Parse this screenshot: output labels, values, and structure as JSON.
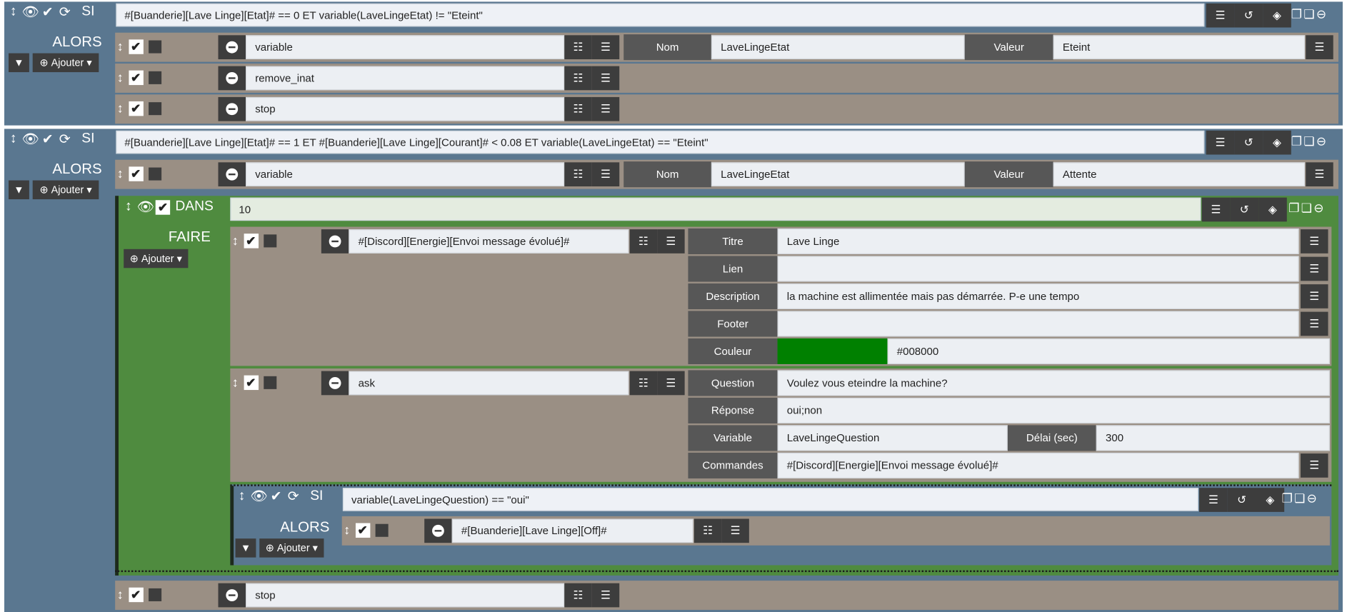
{
  "block1": {
    "si": "SI",
    "condition": "#[Buanderie][Lave Linge][Etat]# == 0  ET variable(LaveLingeEtat)  != \"Eteint\"",
    "alors": "ALORS",
    "ajouter": "Ajouter",
    "actions": [
      {
        "name": "variable",
        "nom_label": "Nom",
        "nom": "LaveLingeEtat",
        "valeur_label": "Valeur",
        "valeur": "Eteint"
      },
      {
        "name": "remove_inat"
      },
      {
        "name": "stop"
      }
    ]
  },
  "block2": {
    "si": "SI",
    "condition": "#[Buanderie][Lave Linge][Etat]# == 1 ET #[Buanderie][Lave Linge][Courant]# < 0.08  ET variable(LaveLingeEtat)  == \"Eteint\"",
    "alors": "ALORS",
    "ajouter": "Ajouter",
    "action1": {
      "name": "variable",
      "nom_label": "Nom",
      "nom": "LaveLingeEtat",
      "valeur_label": "Valeur",
      "valeur": "Attente"
    },
    "dans": {
      "label": "DANS",
      "value": "10",
      "faire": "FAIRE",
      "ajouter": "Ajouter",
      "discord": {
        "name": "#[Discord][Energie][Envoi message évolué]#",
        "titre_label": "Titre",
        "titre": "Lave Linge",
        "lien_label": "Lien",
        "lien": "",
        "description_label": "Description",
        "description": "la machine est allimentée mais pas démarrée. P-e une tempo",
        "footer_label": "Footer",
        "footer": "",
        "couleur_label": "Couleur",
        "couleur": "#008000"
      },
      "ask": {
        "name": "ask",
        "question_label": "Question",
        "question": "Voulez vous eteindre la machine?",
        "reponse_label": "Réponse",
        "reponse": "oui;non",
        "variable_label": "Variable",
        "variable": "LaveLingeQuestion",
        "delai_label": "Délai (sec)",
        "delai": "300",
        "commandes_label": "Commandes",
        "commandes": "#[Discord][Energie][Envoi message évolué]#"
      },
      "inner": {
        "si": "SI",
        "condition": "variable(LaveLingeQuestion)  == \"oui\"",
        "alors": "ALORS",
        "ajouter": "Ajouter",
        "action": "#[Buanderie][Lave Linge][Off]#"
      }
    },
    "last": {
      "name": "stop"
    }
  },
  "colors": {
    "block": "#5a7790",
    "row": "#9a8f84",
    "green": "#4f8b3f",
    "couleur_swatch": "#008000"
  }
}
